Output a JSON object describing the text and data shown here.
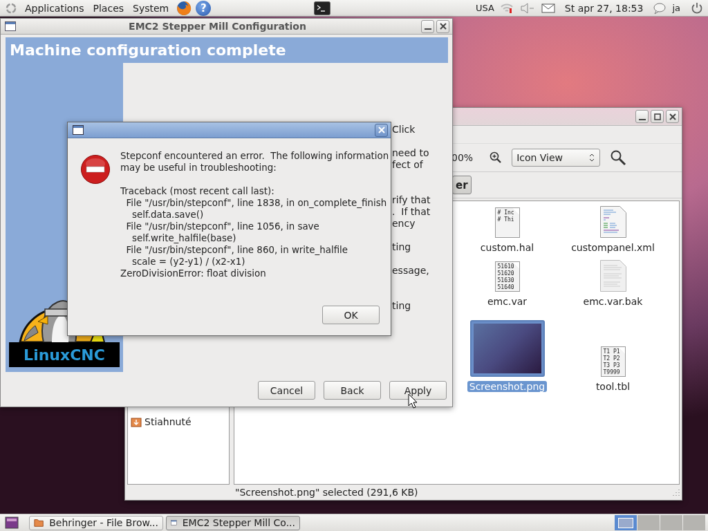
{
  "top_panel": {
    "menus": [
      "Applications",
      "Places",
      "System"
    ],
    "help_glyph": "?",
    "keyboard_layout": "USA",
    "clock": "St apr 27, 18:53",
    "user": "ja"
  },
  "file_browser": {
    "zoom_text": "00%",
    "view_mode": "Icon View",
    "path_button": "er",
    "places": [
      {
        "label": "Stiahnuté"
      }
    ],
    "files": [
      {
        "name": "custom.hal",
        "kind": "text",
        "preview": [
          "# Inc",
          "# Thi"
        ],
        "selected": false
      },
      {
        "name": "custompanel.xml",
        "kind": "code",
        "selected": false
      },
      {
        "name": "emc.var",
        "kind": "text",
        "preview": [
          "51610",
          "51620",
          "51630",
          "51640"
        ],
        "selected": false
      },
      {
        "name": "emc.var.bak",
        "kind": "document",
        "selected": false
      },
      {
        "name": "Screenshot.png",
        "kind": "image",
        "selected": true
      },
      {
        "name": "tool.tbl",
        "kind": "text",
        "preview": [
          "T1 P1",
          "T2 P2",
          "T3 P3",
          "T9999"
        ],
        "selected": false
      }
    ],
    "status": "\"Screenshot.png\" selected (291,6 KB)"
  },
  "stepconf_window": {
    "title": "EMC2 Stepper Mill Configuration",
    "heading": "Machine configuration complete",
    "logo_text": "LinuxCNC",
    "body_fragments": [
      "Click",
      "need to",
      "fect of",
      "rify that",
      ".  If that",
      "ency",
      "ting",
      "essage,",
      "ting"
    ],
    "buttons": [
      {
        "label": "Cancel"
      },
      {
        "label": "Back"
      },
      {
        "label": "Apply"
      }
    ]
  },
  "error_dialog": {
    "intro": "Stepconf encountered an error.  The following information\nmay be useful in troubleshooting:",
    "traceback": "Traceback (most recent call last):\n  File \"/usr/bin/stepconf\", line 1838, in on_complete_finish\n    self.data.save()\n  File \"/usr/bin/stepconf\", line 1056, in save\n    self.write_halfile(base)\n  File \"/usr/bin/stepconf\", line 860, in write_halfile\n    scale = (y2-y1) / (x2-x1)\nZeroDivisionError: float division",
    "button": "OK"
  },
  "taskbar": {
    "tasks": [
      {
        "label": "Behringer - File Brow...",
        "kind": "folder",
        "selected": false
      },
      {
        "label": "EMC2 Stepper Mill Co...",
        "kind": "window",
        "selected": true
      }
    ]
  }
}
